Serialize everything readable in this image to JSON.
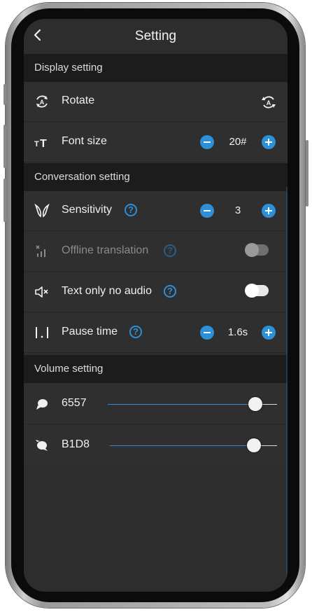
{
  "header": {
    "title": "Setting",
    "back_icon": "chevron-left-icon"
  },
  "display_section": {
    "title": "Display setting",
    "rotate": {
      "label": "Rotate",
      "icon": "rotate-icon",
      "action_icon": "rotate-auto-icon"
    },
    "font_size": {
      "label": "Font size",
      "icon": "font-size-icon",
      "value": "20#"
    }
  },
  "conversation_section": {
    "title": "Conversation setting",
    "sensitivity": {
      "label": "Sensitivity",
      "icon": "sensitivity-icon",
      "help": "?",
      "value": "3"
    },
    "offline": {
      "label": "Offline translation",
      "icon": "offline-signal-icon",
      "help": "?",
      "enabled": false,
      "state": "off"
    },
    "text_only": {
      "label": "Text only no audio",
      "icon": "mute-icon",
      "help": "?",
      "state": "off"
    },
    "pause": {
      "label": "Pause time",
      "icon": "pause-time-icon",
      "help": "?",
      "value": "1.6s"
    }
  },
  "volume_section": {
    "title": "Volume setting",
    "items": [
      {
        "label": "6557",
        "icon": "speech-bubble-icon",
        "level": 0.87
      },
      {
        "label": "B1D8",
        "icon": "speech-bubble-alt-icon",
        "level": 0.86
      }
    ]
  },
  "colors": {
    "accent": "#2e8fd9",
    "background": "#2d2d2d",
    "section_bg": "#1c1c1c"
  }
}
